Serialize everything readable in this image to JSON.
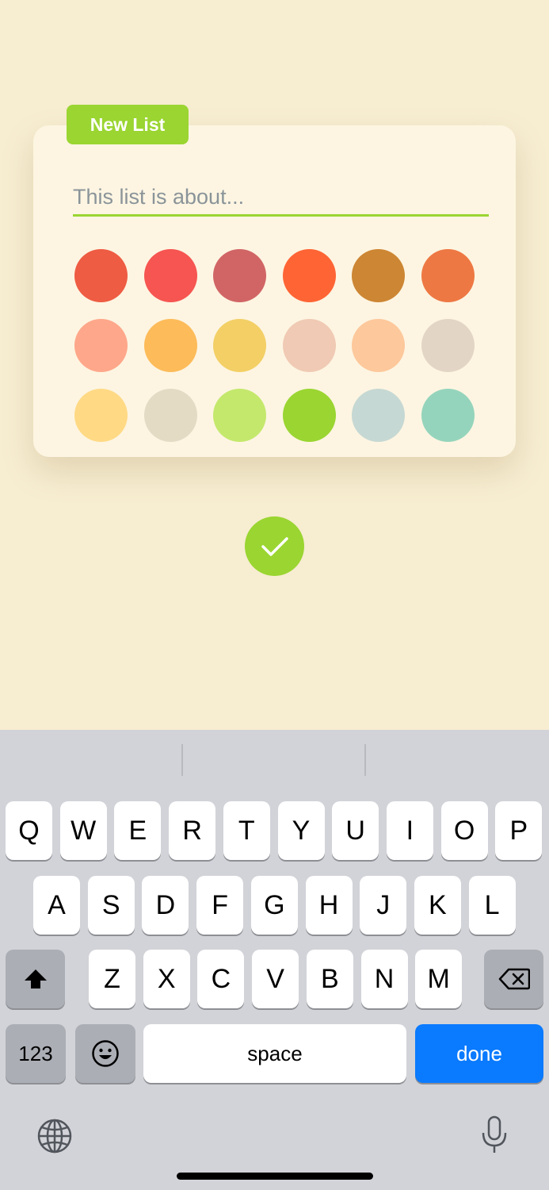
{
  "badge": {
    "label": "New List"
  },
  "title_input": {
    "value": "",
    "placeholder": "This list is about..."
  },
  "swatches": [
    "#ee5c43",
    "#f65551",
    "#d16565",
    "#ff6434",
    "#cd8633",
    "#ee7843",
    "#ffa78a",
    "#fdbb59",
    "#f3cf65",
    "#f0cab4",
    "#fdc89b",
    "#e3d5c5",
    "#ffd984",
    "#e4dbc5",
    "#c4e86c",
    "#9ad531",
    "#c6d8d3",
    "#95d4bc"
  ],
  "confirm": {
    "icon": "checkmark-icon",
    "color": "#9ad531"
  },
  "keyboard": {
    "row1": [
      "Q",
      "W",
      "E",
      "R",
      "T",
      "Y",
      "U",
      "I",
      "O",
      "P"
    ],
    "row2": [
      "A",
      "S",
      "D",
      "F",
      "G",
      "H",
      "J",
      "K",
      "L"
    ],
    "row3": [
      "Z",
      "X",
      "C",
      "V",
      "B",
      "N",
      "M"
    ],
    "numbers_label": "123",
    "space_label": "space",
    "done_label": "done",
    "icons": [
      "shift-icon",
      "backspace-icon",
      "emoji-icon",
      "globe-icon",
      "microphone-icon"
    ]
  },
  "colors": {
    "background": "#f7edd1",
    "card": "#fdf5e2",
    "accent": "#9ad531",
    "done": "#0a7aff"
  }
}
